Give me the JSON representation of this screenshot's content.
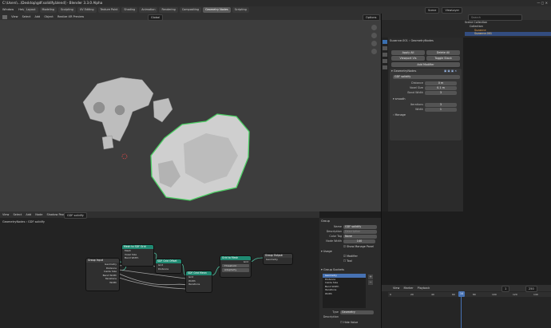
{
  "window": {
    "title": "C:\\Users\\...\\Desktop\\gdf.solidify.blend] - Blender 3.3.0 Alpha"
  },
  "menu": {
    "items": [
      "Window",
      "Help"
    ],
    "workspaces": [
      "Layout",
      "Modeling",
      "Sculpting",
      "UV Editing",
      "Texture Paint",
      "Shading",
      "Animation",
      "Rendering",
      "Compositing",
      "Geometry Nodes",
      "Scripting"
    ],
    "active_workspace": "Geometry Nodes",
    "scene": "Scene",
    "view_layer": "ViewLayer"
  },
  "viewport": {
    "header_items": [
      "View",
      "Select",
      "Add",
      "Object",
      "Realize XR Preview"
    ],
    "mode": "Object Mode",
    "transform": "Global",
    "options": "Options"
  },
  "node_editor": {
    "header_items": [
      "View",
      "Select",
      "Add",
      "Node",
      "Shadow Pass"
    ],
    "editor_type": "GeometryNodes",
    "tree_name": "GDF solidify",
    "nodes": {
      "group_input": {
        "title": "Group Input",
        "sockets": [
          "Geometry",
          "Distance",
          "Inside Size",
          "Bend Width",
          "Iterations",
          "Width"
        ]
      },
      "mesh_to_sdf": {
        "title": "Mesh to SDF Grid",
        "sockets": [
          "Mesh",
          "Voxel Size",
          "Band Width"
        ]
      },
      "sdf_offset": {
        "title": "SDF Grid Offset",
        "sockets": [
          "Grid",
          "Distance"
        ]
      },
      "sdf_smooth": {
        "title": "SDF Grid Mean",
        "sockets": [
          "Grid",
          "Width",
          "Iterations"
        ]
      },
      "grid_to_mesh": {
        "title": "Grid to Mesh",
        "sockets": [
          "Grid",
          "Threshold",
          "Adaptivity"
        ]
      },
      "group_output": {
        "title": "Group Output",
        "sockets": [
          "Geometry"
        ]
      }
    }
  },
  "node_sidebar": {
    "group_header": "Group",
    "name_label": "Name",
    "name_value": "GDF solidify",
    "desc_label": "Description",
    "desc_placeholder": "Description",
    "color_tag_label": "Color Tag",
    "color_tag_value": "None",
    "width_label": "Node Width",
    "width_value": "140",
    "usage_label": "Usage",
    "usage_options": [
      "Modifier",
      "Tool"
    ],
    "show_manage": "Show Manage Panel",
    "sockets_header": "Group Sockets",
    "socket_items": [
      "Geometry",
      "Distance",
      "Inside Size",
      "Bend Width",
      "Iterations",
      "Width"
    ],
    "selected_socket": "Geometry",
    "type_label": "Type",
    "type_value": "Geometry",
    "socket_desc_label": "Description",
    "hide_value": "Hide Value"
  },
  "outliner": {
    "search_placeholder": "Search",
    "root": "Scene Collection",
    "collection": "Collection",
    "items": [
      "Suzanne",
      "Suzanne.001"
    ]
  },
  "properties": {
    "object_name": "Suzanne.001",
    "modifier_tab": "GeometryNodes",
    "apply_all": "Apply All",
    "delete_all": "Delete All",
    "viewport_vis": "Viewport Vis",
    "toggle_stack": "Toggle Stack",
    "add_modifier": "Add Modifier",
    "modifier_name": "GeometryNodes",
    "node_group": "GDF solidify",
    "params": [
      {
        "label": "Distance",
        "value": "0 m"
      },
      {
        "label": "Voxel Size",
        "value": "0.1 m"
      },
      {
        "label": "Band Width",
        "value": "3"
      }
    ],
    "smooth_header": "smooth",
    "smooth_params": [
      {
        "label": "Iterations",
        "value": "3"
      },
      {
        "label": "Width",
        "value": "1"
      }
    ],
    "manage": "Manage"
  },
  "timeline": {
    "header_items": [
      "View",
      "Marker",
      "Playback"
    ],
    "current_frame": "14",
    "start": "1",
    "end": "250",
    "ticks": [
      "0",
      "20",
      "40",
      "60",
      "80",
      "100",
      "120",
      "140"
    ]
  },
  "colors": {
    "accent": "#4772b3",
    "selection_outline": "#4dd065",
    "node_geometry_header": "#1f8a72",
    "node_group_header": "#3b3b3b"
  }
}
